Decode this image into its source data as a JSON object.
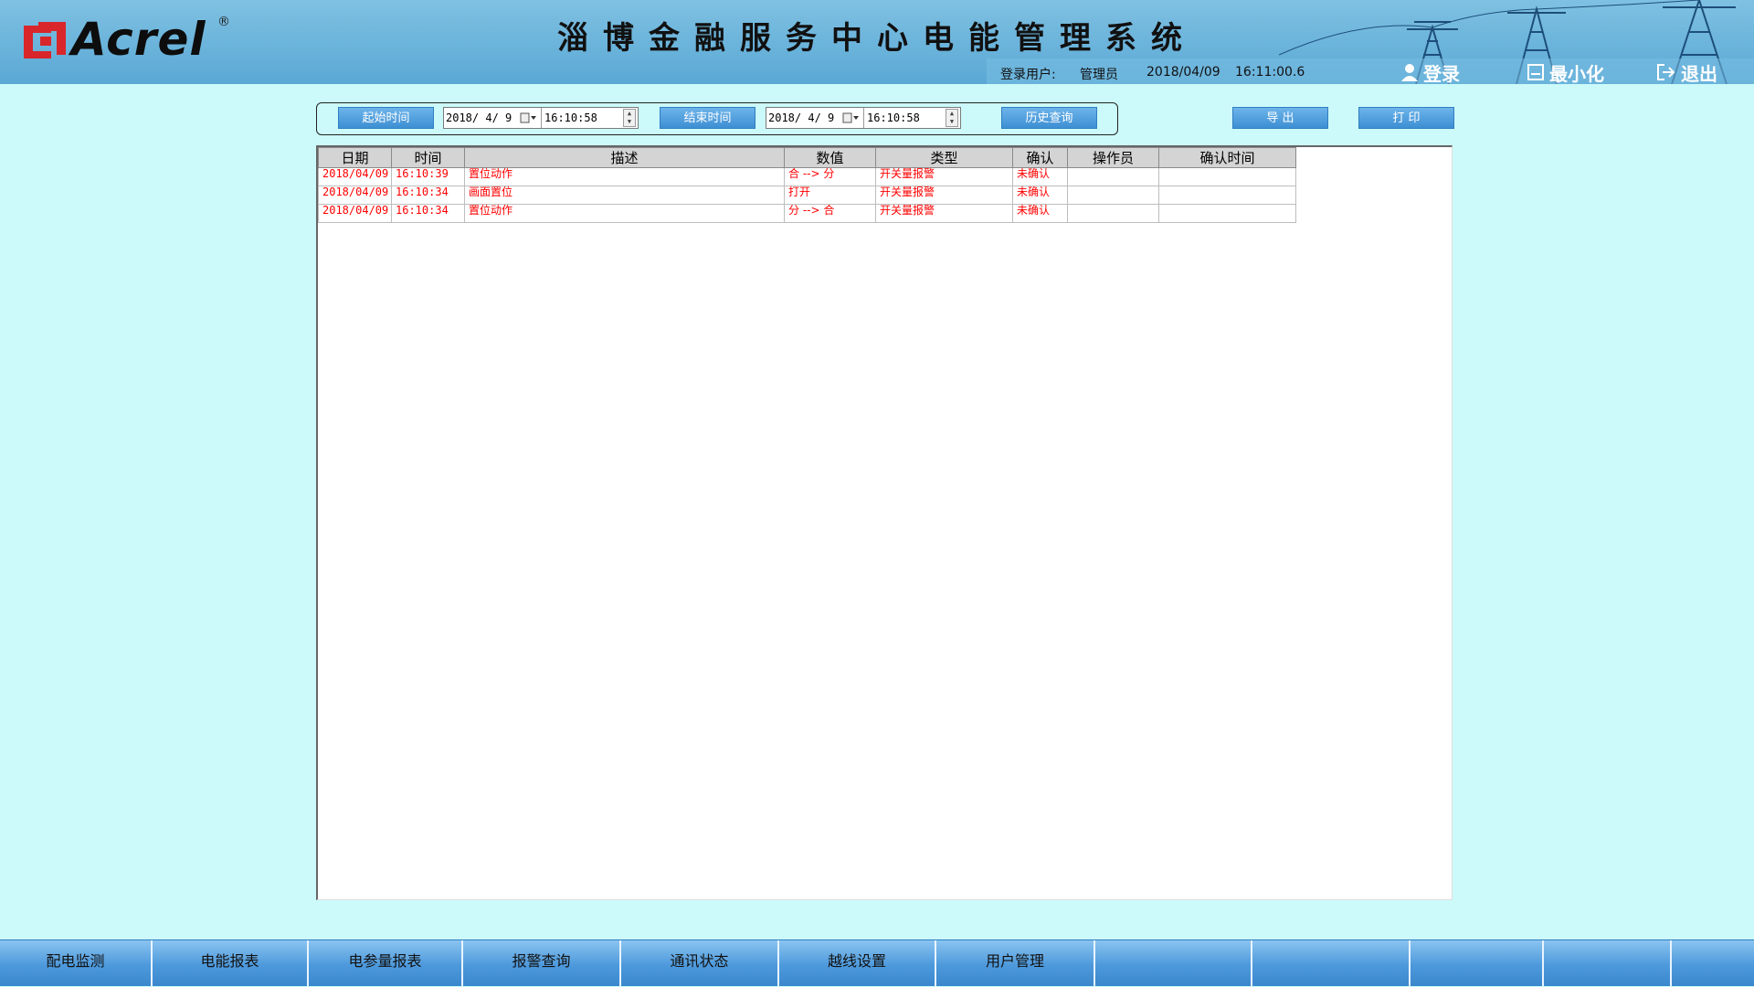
{
  "header": {
    "logo_text": "Acrel",
    "logo_reg": "®",
    "title": "淄博金融服务中心电能管理系统",
    "login_user_label": "登录用户:",
    "login_user": "管理员",
    "date": "2018/04/09",
    "time": "16:11:00.6",
    "buttons": {
      "login": "登录",
      "minimize": "最小化",
      "logout": "退出"
    }
  },
  "filter": {
    "start_button": "起始时间",
    "start_date": "2018/ 4/ 9",
    "start_time": "16:10:58",
    "end_button": "结束时间",
    "end_date": "2018/ 4/ 9",
    "end_time": "16:10:58",
    "query_button": "历史查询",
    "export_button": "导 出",
    "print_button": "打 印"
  },
  "table": {
    "columns": [
      "日期",
      "时间",
      "描述",
      "数值",
      "类型",
      "确认",
      "操作员",
      "确认时间"
    ],
    "rows": [
      [
        "2018/04/09",
        "16:10:39",
        "置位动作",
        "合 --> 分",
        "开关量报警",
        "未确认",
        "",
        ""
      ],
      [
        "2018/04/09",
        "16:10:34",
        "画面置位",
        "打开",
        "开关量报警",
        "未确认",
        "",
        ""
      ],
      [
        "2018/04/09",
        "16:10:34",
        "置位动作",
        "分 --> 合",
        "开关量报警",
        "未确认",
        "",
        ""
      ]
    ]
  },
  "nav": {
    "items": [
      "配电监测",
      "电能报表",
      "电参量报表",
      "报警查询",
      "通讯状态",
      "越线设置",
      "用户管理",
      "",
      "",
      "",
      "",
      ""
    ]
  },
  "colors": {
    "background": "#ccfafa",
    "header": "#5aa8d5",
    "alarm_text": "#ff0000",
    "button": "#3d8fd4",
    "nav": "#4d99dc"
  }
}
